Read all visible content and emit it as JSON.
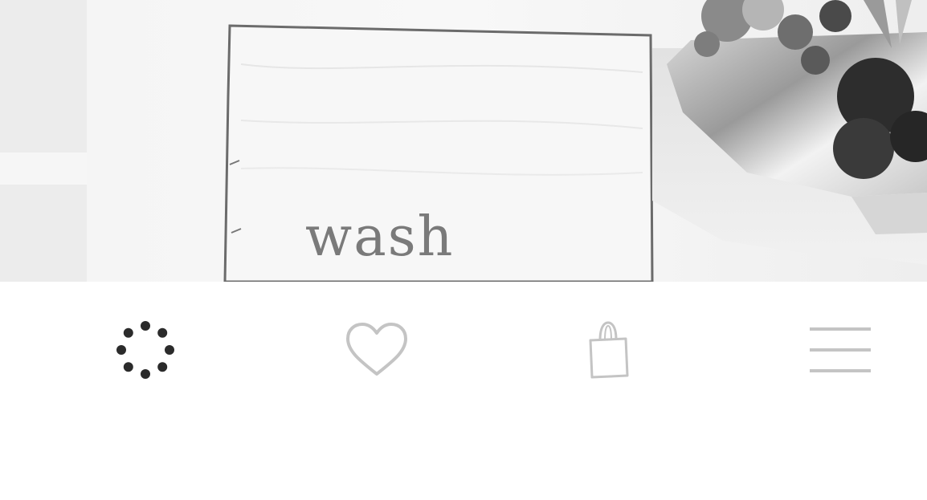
{
  "photo": {
    "sign_text": "wash"
  },
  "tabbar": {
    "items": [
      {
        "icon": "loading-dots-icon",
        "active": true
      },
      {
        "icon": "heart-icon",
        "active": false
      },
      {
        "icon": "shopping-bag-icon",
        "active": false
      },
      {
        "icon": "hamburger-menu-icon",
        "active": false
      }
    ]
  },
  "colors": {
    "active_icon": "#2b2b2b",
    "inactive_icon": "#c4c4c4",
    "background": "#ffffff"
  }
}
